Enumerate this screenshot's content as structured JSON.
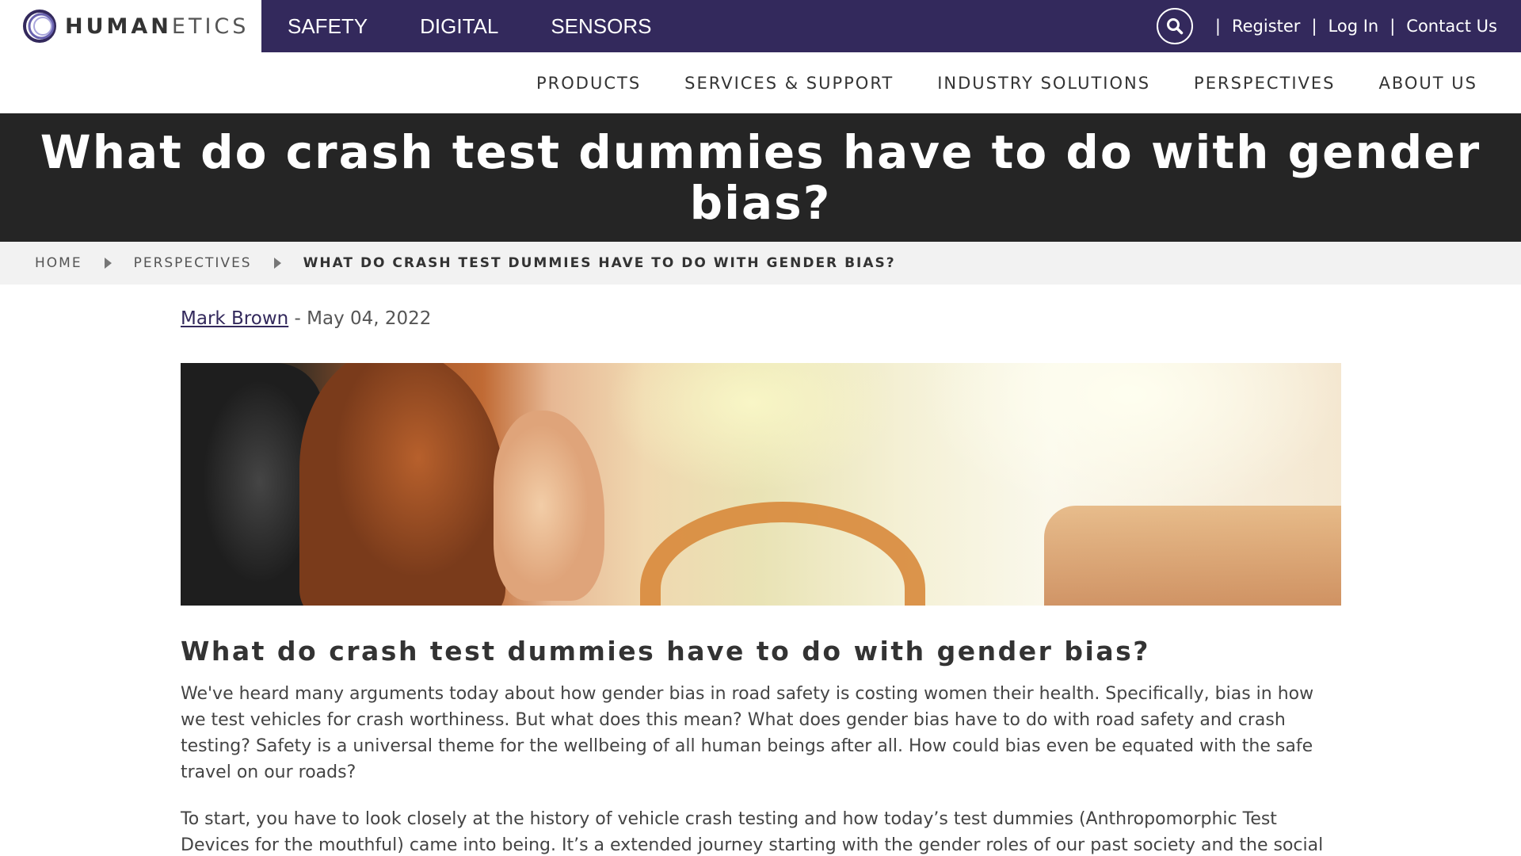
{
  "brand": {
    "logo_text_bold": "HUMAN",
    "logo_text_light": "ETICS"
  },
  "site_tabs": [
    "SAFETY",
    "DIGITAL",
    "SENSORS"
  ],
  "utility": {
    "register": "Register",
    "login": "Log In",
    "contact": "Contact Us",
    "separator": "|"
  },
  "main_nav": [
    "PRODUCTS",
    "SERVICES & SUPPORT",
    "INDUSTRY SOLUTIONS",
    "PERSPECTIVES",
    "ABOUT US"
  ],
  "hero": {
    "title": "What do crash test dummies have to do with gender bias?"
  },
  "breadcrumb": {
    "home": "HOME",
    "section": "PERSPECTIVES",
    "current": "WHAT DO CRASH TEST DUMMIES HAVE TO DO WITH GENDER BIAS?"
  },
  "article": {
    "author": "Mark Brown",
    "date_sep": " - ",
    "date": "May 04, 2022",
    "heading": "What do crash test dummies have to do with gender bias?",
    "paragraphs": [
      "We've heard many arguments today about how gender bias in road safety is costing women their health. Specifically, bias in how we test vehicles for crash worthiness. But what does this mean? What does gender bias have to do with road safety and crash testing? Safety is a universal theme for the wellbeing of all human beings after all. How could bias even be equated with the safe travel on our roads?",
      "To start, you have to look closely at the history of vehicle crash testing and how today’s test dummies (Anthropomorphic Test Devices for the mouthful) came into being. It’s a extended journey starting with the gender roles of our past society and the social norms of a bygone"
    ]
  },
  "colors": {
    "topbar": "#33295c",
    "hero_bg": "#252525",
    "breadcrumb_bg": "#f2f2f2",
    "link": "#33295c"
  },
  "icons": {
    "search": "search-icon",
    "logo": "humanetics-logo-icon",
    "breadcrumb_arrow": "caret-right-icon"
  }
}
